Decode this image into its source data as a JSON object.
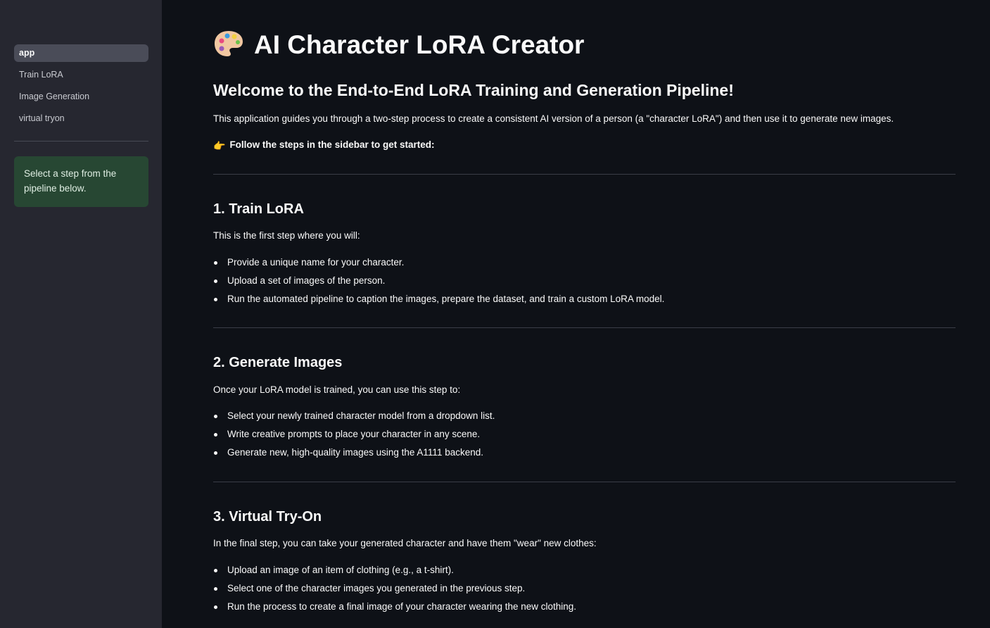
{
  "sidebar": {
    "nav": [
      {
        "label": "app",
        "active": true
      },
      {
        "label": "Train LoRA",
        "active": false
      },
      {
        "label": "Image Generation",
        "active": false
      },
      {
        "label": "virtual tryon",
        "active": false
      }
    ],
    "info": "Select a step from the pipeline below."
  },
  "main": {
    "title": "AI Character LoRA Creator",
    "title_icon": "artist-palette-icon",
    "welcome": "Welcome to the End-to-End LoRA Training and Generation Pipeline!",
    "intro": "This application guides you through a two-step process to create a consistent AI version of a person (a \"character LoRA\") and then use it to generate new images.",
    "cta_icon": "pointing-hand-icon",
    "cta": "Follow the steps in the sidebar to get started:",
    "sections": [
      {
        "heading": "1. Train LoRA",
        "lead": "This is the first step where you will:",
        "items": [
          "Provide a unique name for your character.",
          "Upload a set of images of the person.",
          "Run the automated pipeline to caption the images, prepare the dataset, and train a custom LoRA model."
        ]
      },
      {
        "heading": "2. Generate Images",
        "lead": "Once your LoRA model is trained, you can use this step to:",
        "items": [
          "Select your newly trained character model from a dropdown list.",
          "Write creative prompts to place your character in any scene.",
          "Generate new, high-quality images using the A1111 backend."
        ]
      },
      {
        "heading": "3. Virtual Try-On",
        "lead": "In the final step, you can take your generated character and have them \"wear\" new clothes:",
        "items": [
          "Upload an image of an item of clothing (e.g., a t-shirt).",
          "Select one of the character images you generated in the previous step.",
          "Run the process to create a final image of your character wearing the new clothing."
        ]
      }
    ]
  },
  "colors": {
    "sidebar_bg": "#262730",
    "main_bg": "#0e1117",
    "info_bg": "#274733",
    "active_nav_bg": "#4a4c58"
  }
}
